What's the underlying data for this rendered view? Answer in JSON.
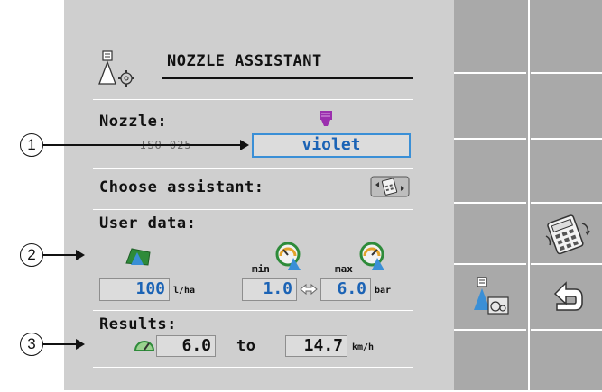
{
  "title": "NOZZLE ASSISTANT",
  "nozzle": {
    "label": "Nozzle:",
    "iso_code": "ISO 025",
    "value": "violet"
  },
  "choose_assistant": {
    "label": "Choose assistant:"
  },
  "user_data": {
    "label": "User data:",
    "rate_value": "100",
    "rate_unit": "l/ha",
    "min_label": "min",
    "max_label": "max",
    "min_pressure": "1.0",
    "max_pressure": "6.0",
    "pressure_unit": "bar"
  },
  "results": {
    "label": "Results:",
    "from": "6.0",
    "to_label": "to",
    "to": "14.7",
    "unit": "km/h"
  },
  "callouts": [
    "1",
    "2",
    "3"
  ],
  "colors": {
    "screen_bg": "#cfcfcf",
    "softkey_bg": "#a9a9a9",
    "value_blue": "#1b63b5",
    "nozzle_violet": "#9b2fae",
    "icon_green": "#2e8b3a"
  }
}
